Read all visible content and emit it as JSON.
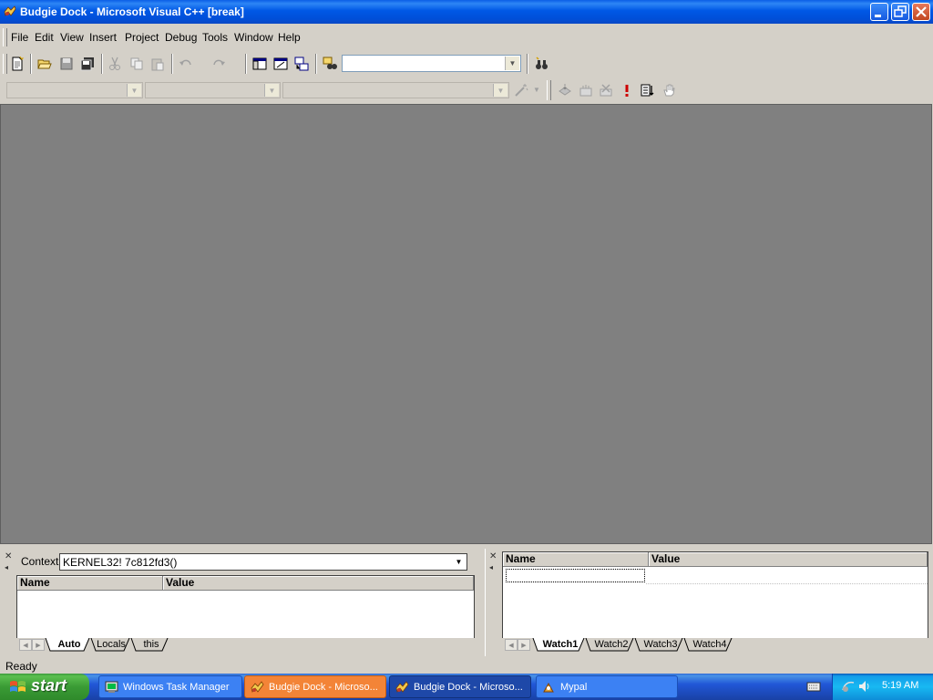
{
  "window": {
    "title": "Budgie Dock - Microsoft Visual C++ [break]"
  },
  "menu": [
    {
      "label": "File"
    },
    {
      "label": "Edit"
    },
    {
      "label": "View"
    },
    {
      "label": "Insert"
    },
    {
      "label": "Project"
    },
    {
      "label": "Debug"
    },
    {
      "label": "Tools"
    },
    {
      "label": "Window"
    },
    {
      "label": "Help"
    }
  ],
  "toolbar": {
    "find_combo_value": "",
    "wizard_combo1_value": "",
    "wizard_combo2_value": "",
    "wizard_combo3_value": ""
  },
  "variables_pane": {
    "context_label": "Context:",
    "context_value": "KERNEL32! 7c812fd3()",
    "columns": [
      "Name",
      "Value"
    ],
    "tabs": [
      "Auto",
      "Locals",
      "this"
    ],
    "active_tab": "Auto"
  },
  "watch_pane": {
    "columns": [
      "Name",
      "Value"
    ],
    "tabs": [
      "Watch1",
      "Watch2",
      "Watch3",
      "Watch4"
    ],
    "active_tab": "Watch1"
  },
  "status": {
    "text": "Ready"
  },
  "taskbar": {
    "start_label": "start",
    "tasks": [
      {
        "label": "Windows Task Manager",
        "icon": "task-manager-icon"
      },
      {
        "label": "Budgie Dock - Microso...",
        "icon": "visual-cpp-icon"
      },
      {
        "label": "Budgie Dock - Microso...",
        "icon": "visual-cpp-icon"
      },
      {
        "label": "Mypal",
        "icon": "mypal-icon"
      }
    ],
    "clock": "5:19 AM"
  },
  "colors": {
    "titlebar": "#0058e6",
    "workspace": "#808080",
    "chrome": "#d4d0c8",
    "taskbar": "#2157d7",
    "start": "#3a9b35",
    "flashing_task": "#f38437"
  }
}
